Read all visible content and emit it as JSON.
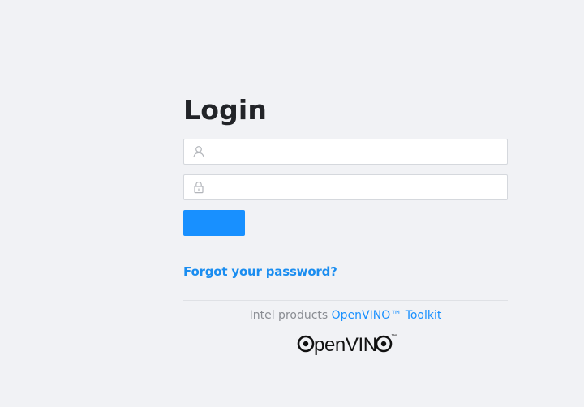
{
  "login": {
    "title": "Login",
    "username": {
      "value": "",
      "icon": "user-icon"
    },
    "password": {
      "value": "",
      "icon": "lock-icon"
    },
    "submit_label": "",
    "forgot_password": "Forgot your password?"
  },
  "footer": {
    "product_prefix": "Intel products",
    "product_link": "OpenVINO™ Toolkit",
    "logo_text": "OpenVINO",
    "logo_mark": "™"
  },
  "colors": {
    "background": "#f1f2f5",
    "accent": "#1890ff",
    "title": "#222428",
    "field_border": "#d5d8dd"
  }
}
